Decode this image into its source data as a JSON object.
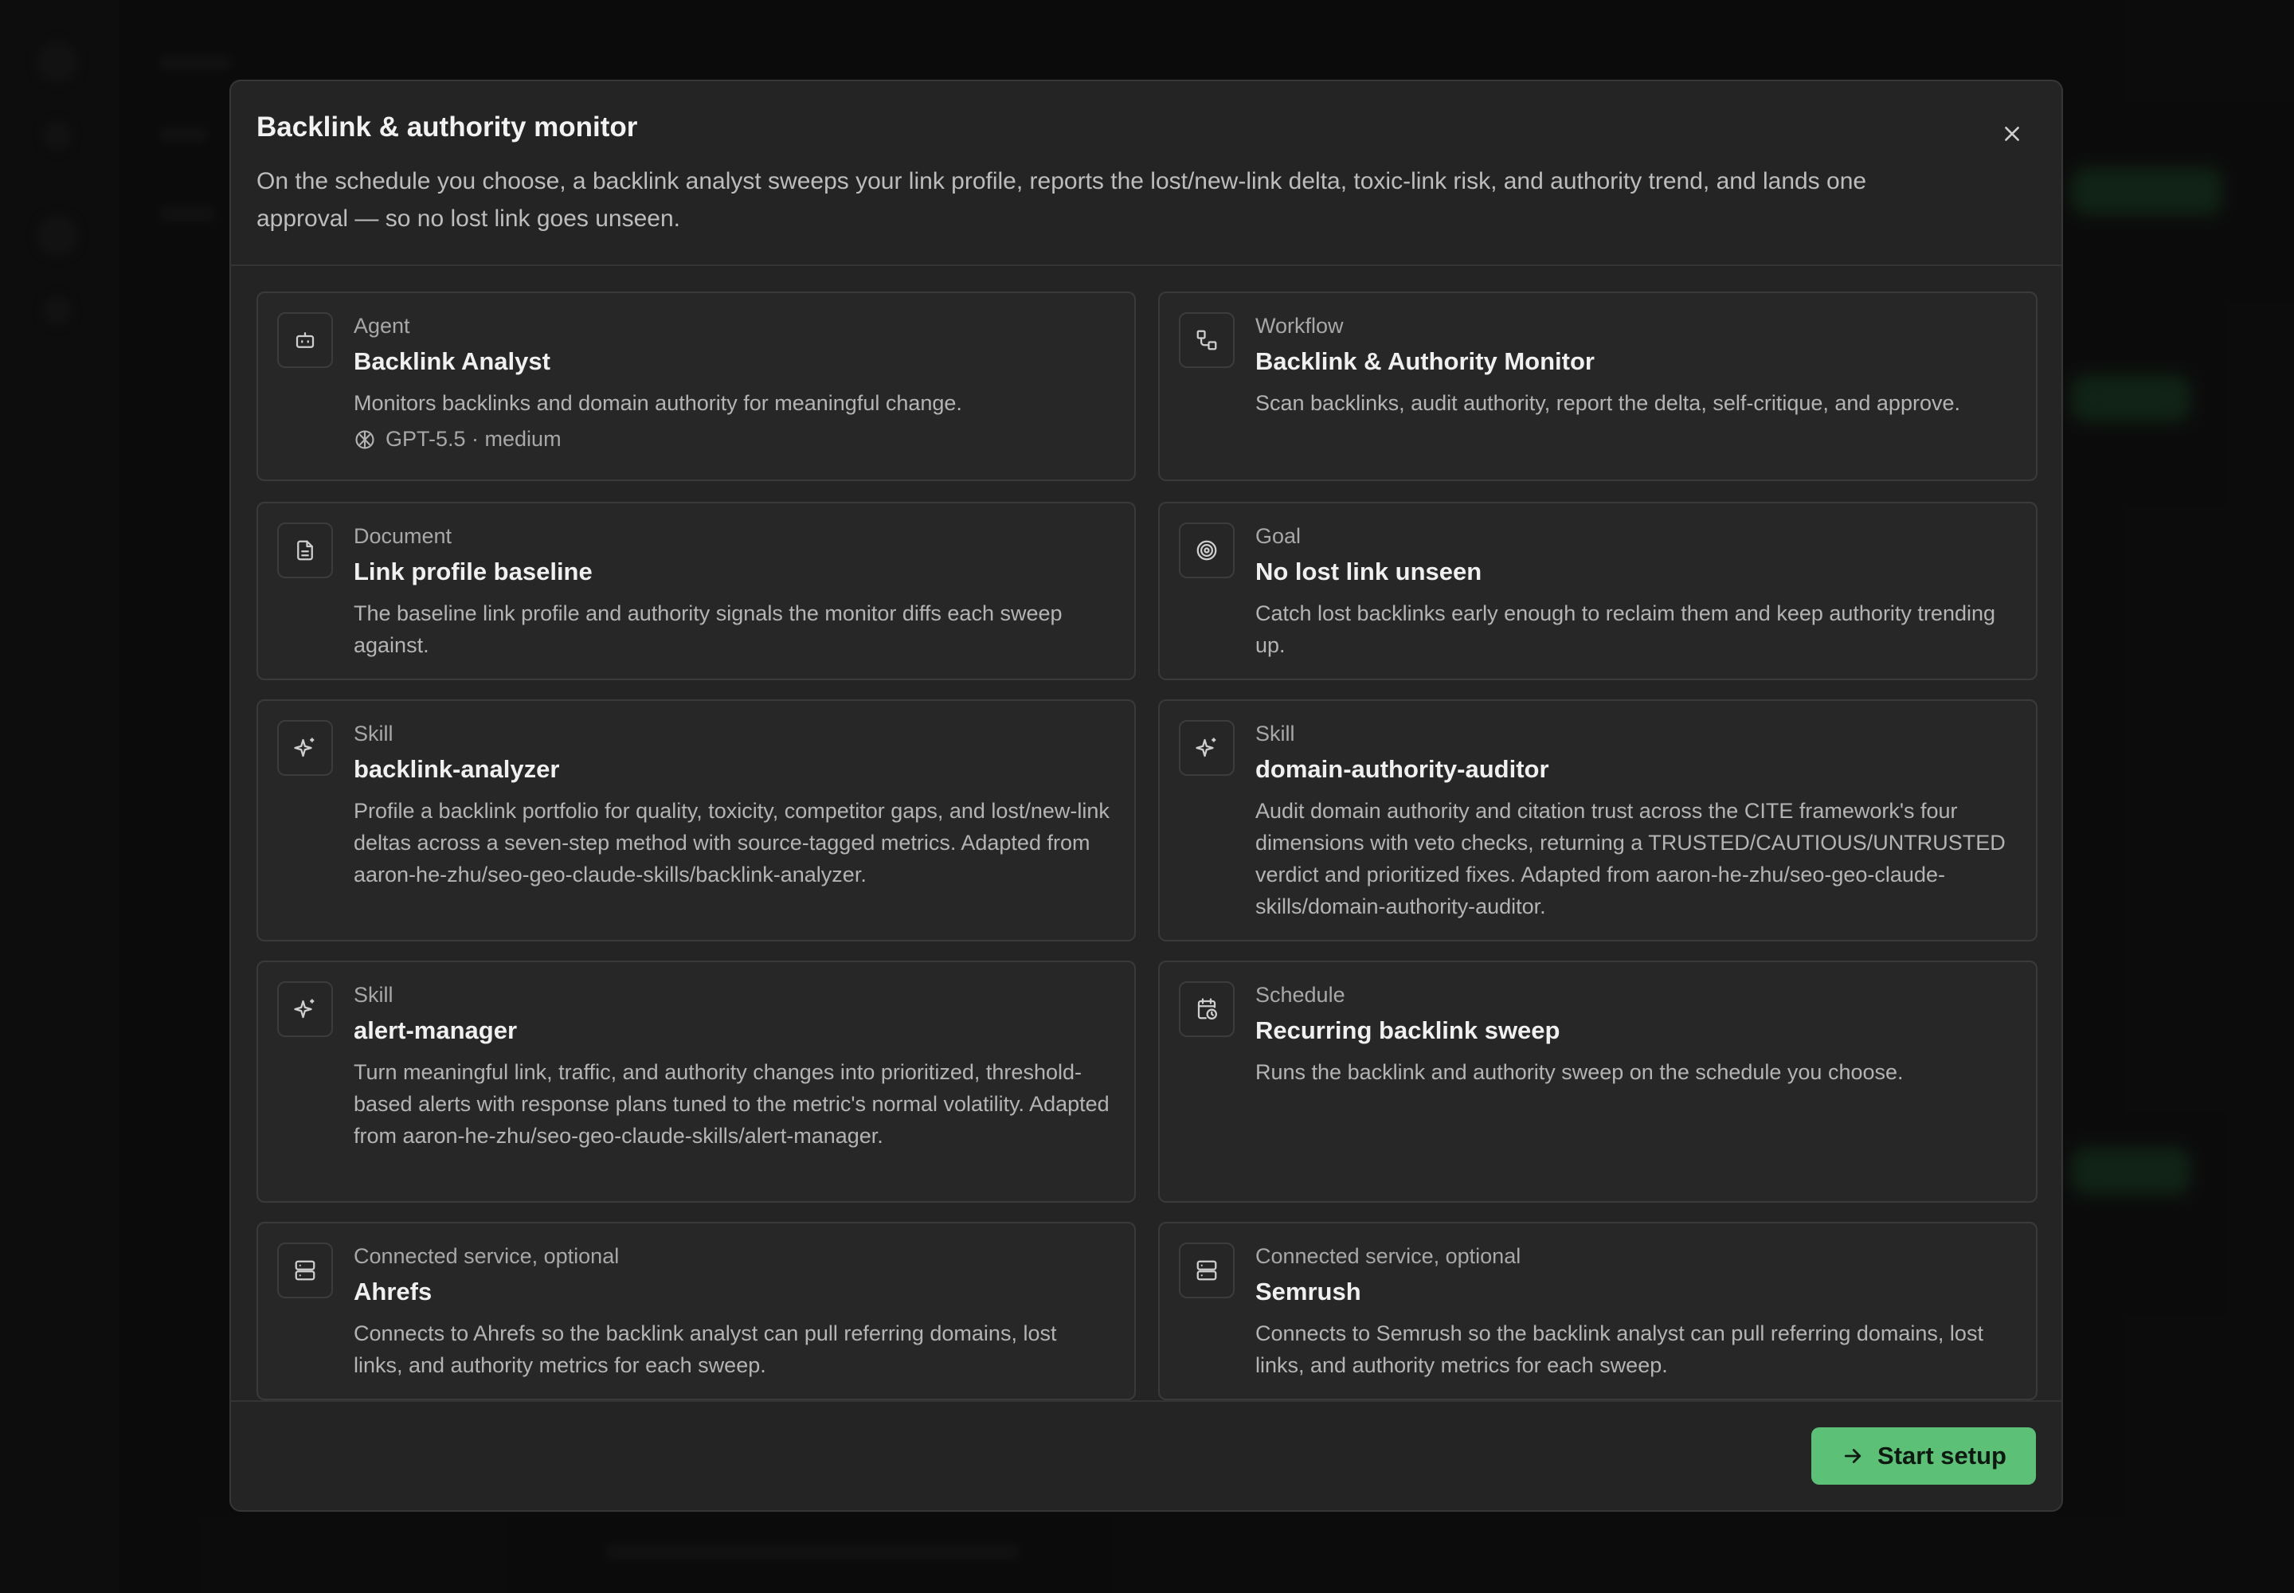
{
  "dialog": {
    "title": "Backlink & authority monitor",
    "description": "On the schedule you choose, a backlink analyst sweeps your link profile, reports the lost/new-link delta, toxic-link risk, and authority trend, and lands one approval — so no lost link goes unseen.",
    "close_icon": "close-icon",
    "start_label": "Start setup",
    "start_icon": "arrow-right-icon"
  },
  "cards": [
    {
      "kind": "Agent",
      "name": "Backlink Analyst",
      "description": "Monitors backlinks and domain authority for meaningful change.",
      "meta": "GPT-5.5 · medium",
      "icon": "bot-icon",
      "meta_icon": "model-icon"
    },
    {
      "kind": "Workflow",
      "name": "Backlink & Authority Monitor",
      "description": "Scan backlinks, audit authority, report the delta, self-critique, and approve.",
      "icon": "workflow-icon"
    },
    {
      "kind": "Document",
      "name": "Link profile baseline",
      "description": "The baseline link profile and authority signals the monitor diffs each sweep against.",
      "icon": "document-icon"
    },
    {
      "kind": "Goal",
      "name": "No lost link unseen",
      "description": "Catch lost backlinks early enough to reclaim them and keep authority trending up.",
      "icon": "target-icon"
    },
    {
      "kind": "Skill",
      "name": "backlink-analyzer",
      "description": "Profile a backlink portfolio for quality, toxicity, competitor gaps, and lost/new-link deltas across a seven-step method with source-tagged metrics. Adapted from aaron-he-zhu/seo-geo-claude-skills/backlink-analyzer.",
      "icon": "sparkles-icon"
    },
    {
      "kind": "Skill",
      "name": "domain-authority-auditor",
      "description": "Audit domain authority and citation trust across the CITE framework's four dimensions with veto checks, returning a TRUSTED/CAUTIOUS/UNTRUSTED verdict and prioritized fixes. Adapted from aaron-he-zhu/seo-geo-claude-skills/domain-authority-auditor.",
      "icon": "sparkles-icon"
    },
    {
      "kind": "Skill",
      "name": "alert-manager",
      "description": "Turn meaningful link, traffic, and authority changes into prioritized, threshold-based alerts with response plans tuned to the metric's normal volatility. Adapted from aaron-he-zhu/seo-geo-claude-skills/alert-manager.",
      "icon": "sparkles-icon"
    },
    {
      "kind": "Schedule",
      "name": "Recurring backlink sweep",
      "description": "Runs the backlink and authority sweep on the schedule you choose.",
      "icon": "calendar-clock-icon"
    },
    {
      "kind": "Connected service, optional",
      "name": "Ahrefs",
      "description": "Connects to Ahrefs so the backlink analyst can pull referring domains, lost links, and authority metrics for each sweep.",
      "icon": "server-icon"
    },
    {
      "kind": "Connected service, optional",
      "name": "Semrush",
      "description": "Connects to Semrush so the backlink analyst can pull referring domains, lost links, and authority metrics for each sweep.",
      "icon": "server-icon"
    }
  ],
  "colors": {
    "accent": "#5cc177",
    "surface": "#242424",
    "card": "#272727"
  }
}
